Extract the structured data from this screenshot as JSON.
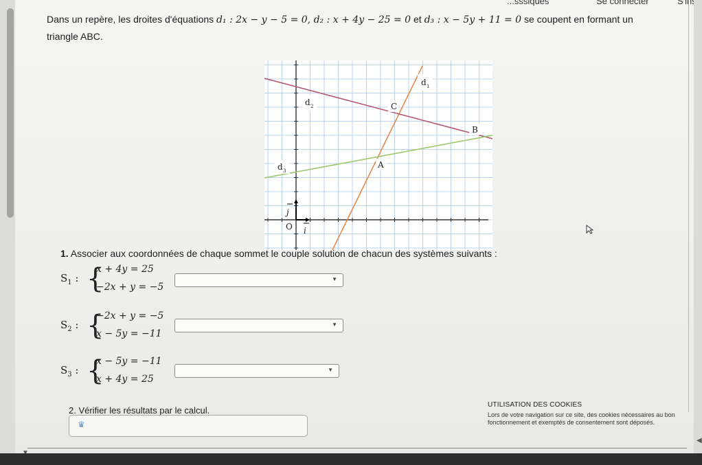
{
  "nav": {
    "item1": "...sssiques",
    "item2": "Se connecter",
    "item3": "S'insc"
  },
  "intro": {
    "p1": "Dans un repère, les droites d'équations ",
    "d1": "d₁",
    "eq1": " : 2x − y − 5 = 0, ",
    "d2": "d₂",
    "eq2": " : x + 4y − 25 = 0",
    "et": " et ",
    "d3": "d₃",
    "eq3": " : x − 5y + 11 = 0",
    "p2": " se coupent en formant un",
    "p3": "triangle ABC."
  },
  "graph": {
    "line_labels": {
      "d1": "d",
      "d2": "d",
      "d3": "d"
    },
    "point_labels": {
      "a": "A",
      "b": "B",
      "c": "C"
    },
    "origin": "O",
    "unit_i": "i",
    "unit_j": "j",
    "colors": {
      "d1": "#e58a4a",
      "d2": "#b55a73",
      "d3": "#9cc86a",
      "grid": "#a9c6e6"
    }
  },
  "question1": {
    "number": "1.",
    "text": " Associer aux coordonnées de chaque sommet le couple solution de chacun des systèmes suivants :"
  },
  "systems": [
    {
      "name": "S",
      "sub": "1",
      "eq_top": "x + 4y = 25",
      "eq_bottom": "−2x + y = −5"
    },
    {
      "name": "S",
      "sub": "2",
      "eq_top": "−2x + y = −5",
      "eq_bottom": "x − 5y = −11"
    },
    {
      "name": "S",
      "sub": "3",
      "eq_top": "x − 5y = −11",
      "eq_bottom": "x + 4y = 25"
    }
  ],
  "question2": {
    "text": "2. Vérifier les résultats par le calcul."
  },
  "cookies": {
    "title": "UTILISATION DES COOKIES",
    "text": "Lors de votre navigation sur ce site, des cookies nécessaires au bon fonctionnement et exemptés de consentement sont déposés."
  }
}
